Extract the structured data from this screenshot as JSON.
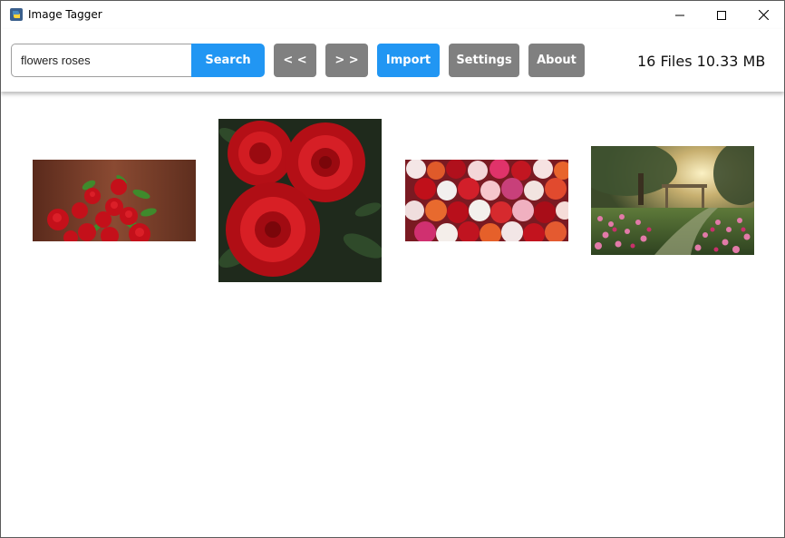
{
  "window": {
    "title": "Image Tagger",
    "icon": "python-icon"
  },
  "toolbar": {
    "search_value": "flowers roses",
    "search_label": "Search",
    "prev_label": "< <",
    "next_label": "> >",
    "import_label": "Import",
    "settings_label": "Settings",
    "about_label": "About",
    "stats": "16 Files 10.33 MB"
  },
  "colors": {
    "primary": "#2196f3",
    "secondary": "#808080"
  },
  "gallery": {
    "thumbnails": [
      {
        "name": "red-rose-bouquet"
      },
      {
        "name": "red-roses-closeup"
      },
      {
        "name": "mixed-roses"
      },
      {
        "name": "rose-garden"
      }
    ]
  }
}
